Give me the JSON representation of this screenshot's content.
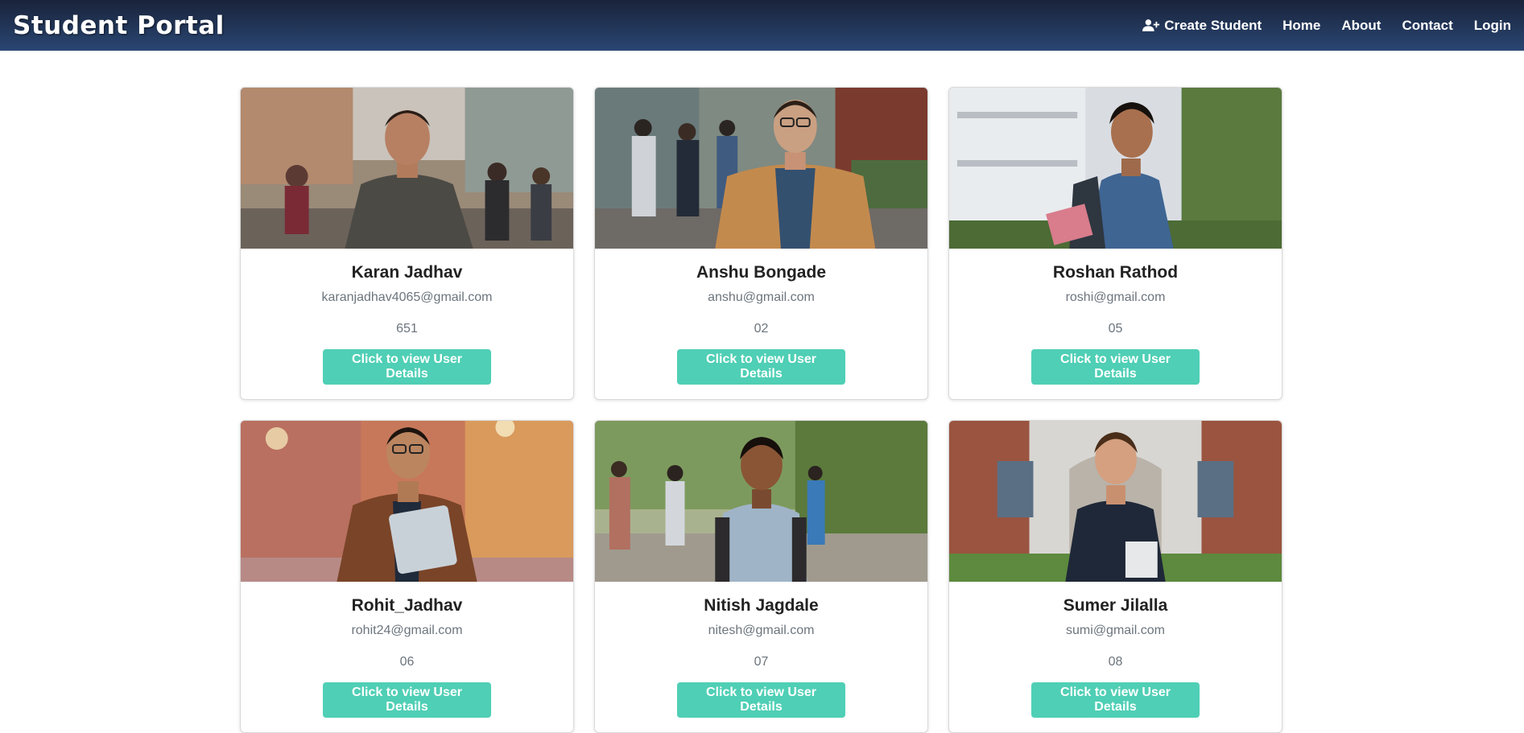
{
  "nav": {
    "brand": "Student Portal",
    "links": [
      {
        "label": "Create Student",
        "icon": "user-plus-icon"
      },
      {
        "label": "Home"
      },
      {
        "label": "About"
      },
      {
        "label": "Contact"
      },
      {
        "label": "Login"
      }
    ]
  },
  "students": [
    {
      "name": "Karan Jadhav",
      "email": "karanjadhav4065@gmail.com",
      "roll": "651",
      "button": "Click to view User Details"
    },
    {
      "name": "Anshu Bongade",
      "email": "anshu@gmail.com",
      "roll": "02",
      "button": "Click to view User Details"
    },
    {
      "name": "Roshan Rathod",
      "email": "roshi@gmail.com",
      "roll": "05",
      "button": "Click to view User Details"
    },
    {
      "name": "Rohit_Jadhav",
      "email": "rohit24@gmail.com",
      "roll": "06",
      "button": "Click to view User Details"
    },
    {
      "name": "Nitish Jagdale",
      "email": "nitesh@gmail.com",
      "roll": "07",
      "button": "Click to view User Details"
    },
    {
      "name": "Sumer Jilalla",
      "email": "sumi@gmail.com",
      "roll": "08",
      "button": "Click to view User Details"
    }
  ],
  "colors": {
    "navbar_top": "#19233a",
    "navbar_bottom": "#2a4673",
    "button": "#4fcfb5"
  }
}
